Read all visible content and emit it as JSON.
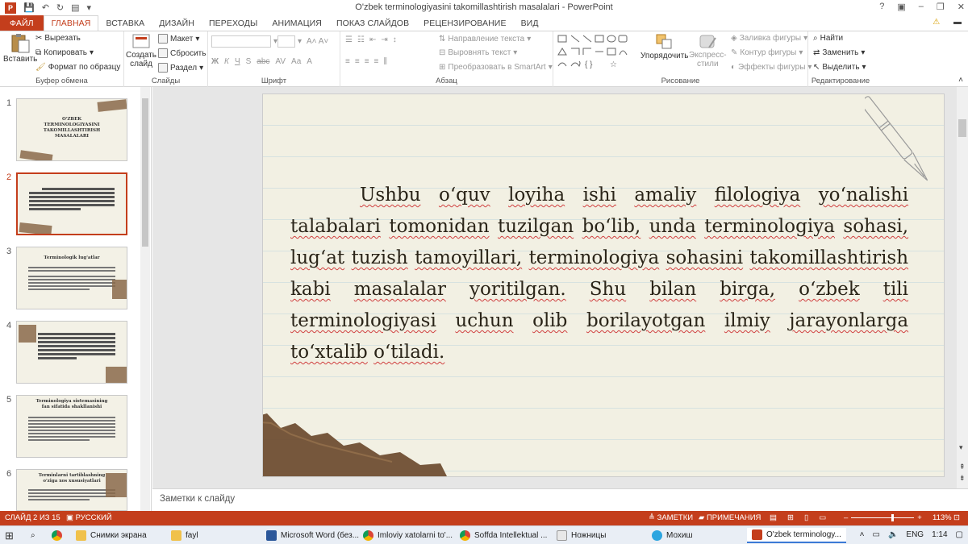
{
  "window": {
    "title": "O'zbek terminologiyasini takomillashtirish masalalari - PowerPoint",
    "help": "?",
    "minimize": "–",
    "restore": "❐",
    "close": "✕"
  },
  "tabs": [
    {
      "label": "ФАЙЛ"
    },
    {
      "label": "ГЛАВНАЯ"
    },
    {
      "label": "ВСТАВКА"
    },
    {
      "label": "ДИЗАЙН"
    },
    {
      "label": "ПЕРЕХОДЫ"
    },
    {
      "label": "АНИМАЦИЯ"
    },
    {
      "label": "ПОКАЗ СЛАЙДОВ"
    },
    {
      "label": "РЕЦЕНЗИРОВАНИЕ"
    },
    {
      "label": "ВИД"
    }
  ],
  "ribbon": {
    "clipboard": {
      "paste": "Вставить",
      "cut": "Вырезать",
      "copy": "Копировать",
      "format_painter": "Формат по образцу",
      "label": "Буфер обмена"
    },
    "slides": {
      "new_slide_1": "Создать",
      "new_slide_2": "слайд",
      "layout": "Макет",
      "reset": "Сбросить",
      "section": "Раздел",
      "label": "Слайды"
    },
    "font": {
      "bold": "Ж",
      "italic": "К",
      "underline": "Ч",
      "shadow": "S",
      "strike": "abc",
      "spacing": "AV",
      "case": "Aa",
      "label": "Шрифт"
    },
    "paragraph": {
      "text_direction": "Направление текста",
      "align_text": "Выровнять текст",
      "smartart": "Преобразовать в SmartArt",
      "label": "Абзац"
    },
    "drawing": {
      "arrange": "Упорядочить",
      "quick_styles_1": "Экспресс-",
      "quick_styles_2": "стили",
      "shape_fill": "Заливка фигуры",
      "shape_outline": "Контур фигуры",
      "shape_effects": "Эффекты фигуры",
      "label": "Рисование"
    },
    "editing": {
      "find": "Найти",
      "replace": "Заменить",
      "select": "Выделить",
      "label": "Редактирование"
    }
  },
  "thumbnails": [
    {
      "num": "1",
      "title": "O'ZBEK TERMINOLOGIYASINI TAKOMILLASHTIRISH MASALALARI"
    },
    {
      "num": "2",
      "title": ""
    },
    {
      "num": "3",
      "title": "Terminologik lug'atlar"
    },
    {
      "num": "4",
      "title": ""
    },
    {
      "num": "5",
      "title": "Terminologiya sistemasining fan sifatida shakllanishi"
    },
    {
      "num": "6",
      "title": "Terminlarni tartiblashning o'ziga xos xususiyatlari"
    }
  ],
  "slide": {
    "words": [
      "Ushbu",
      "o‘quv",
      "loyiha",
      "ishi",
      "amaliy",
      "filologiya",
      "yo‘nalishi",
      "talabalari",
      "tomonidan",
      "tuzilgan",
      "bo‘lib,",
      "unda",
      "terminologiya",
      "sohasi,",
      "lug‘at",
      "tuzish",
      "tamoyillari,",
      "terminologiya",
      "sohasini",
      "takomillashtirish",
      "kabi",
      "masalalar",
      "yoritilgan.",
      "Shu",
      "bilan",
      "birga,",
      "o‘zbek",
      "tili",
      "terminologiyasi",
      "uchun",
      "olib",
      "borilayotgan",
      "ilmiy",
      "jarayonlarga",
      "to‘xtalib",
      "o‘tiladi."
    ]
  },
  "notes": {
    "placeholder": "Заметки к слайду"
  },
  "status": {
    "slide_of": "СЛАЙД 2 ИЗ 15",
    "language": "РУССКИЙ",
    "notes_btn": "ЗАМЕТКИ",
    "comments_btn": "ПРИМЕЧАНИЯ",
    "zoom": "113%"
  },
  "taskbar": {
    "items": [
      {
        "label": "Снимки экрана"
      },
      {
        "label": "fayl"
      },
      {
        "label": "Microsoft Word (без..."
      },
      {
        "label": "Imloviy xatolarni to'..."
      },
      {
        "label": "Soffda Intellektual ..."
      },
      {
        "label": "Ножницы"
      },
      {
        "label": "Мохиш"
      },
      {
        "label": "O'zbek terminology..."
      }
    ],
    "lang": "ENG",
    "time": "1:14"
  },
  "colors": {
    "accent": "#c43e1c"
  }
}
